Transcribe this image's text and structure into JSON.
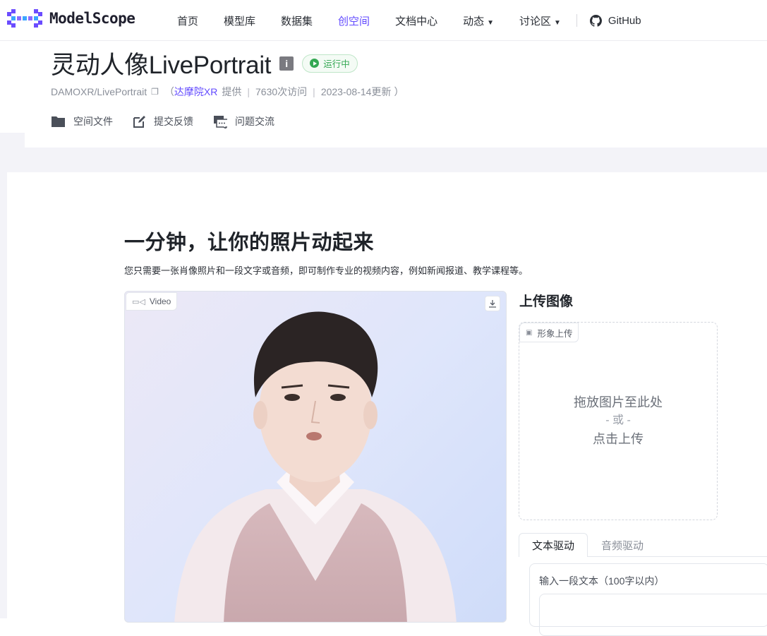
{
  "nav": {
    "logo_text": "ModelScope",
    "items": [
      {
        "label": "首页",
        "active": false
      },
      {
        "label": "模型库",
        "active": false
      },
      {
        "label": "数据集",
        "active": false
      },
      {
        "label": "创空间",
        "active": true
      },
      {
        "label": "文档中心",
        "active": false
      },
      {
        "label": "动态",
        "active": false,
        "dropdown": true
      },
      {
        "label": "讨论区",
        "active": false,
        "dropdown": true
      }
    ],
    "github_label": "GitHub",
    "accent_color": "#624aff"
  },
  "header": {
    "title": "灵动人像LivePortrait",
    "info_icon": "i",
    "status": "运行中",
    "repo": "DAMOXR/LivePortrait",
    "provider_open": "（",
    "provider": "达摩院XR",
    "provided_label": "提供",
    "visits": "7630次访问",
    "updated": "2023-08-14更新",
    "provider_close": "）",
    "actions": [
      {
        "label": "空间文件",
        "icon": "folder-icon"
      },
      {
        "label": "提交反馈",
        "icon": "edit-icon"
      },
      {
        "label": "问题交流",
        "icon": "chat-icon"
      }
    ]
  },
  "main": {
    "heading": "一分钟，让你的照片动起来",
    "description": "您只需要一张肖像照片和一段文字或音频，即可制作专业的视频内容，例如新闻报道、教学课程等。",
    "video_label": "Video",
    "upload_title": "上传图像",
    "upload_tag": "形象上传",
    "drop_line1": "拖放图片至此处",
    "drop_or": "- 或 -",
    "drop_line2": "点击上传",
    "tabs": [
      {
        "label": "文本驱动",
        "active": true
      },
      {
        "label": "音频驱动",
        "active": false
      }
    ],
    "text_label": "输入一段文本（100字以内）"
  }
}
